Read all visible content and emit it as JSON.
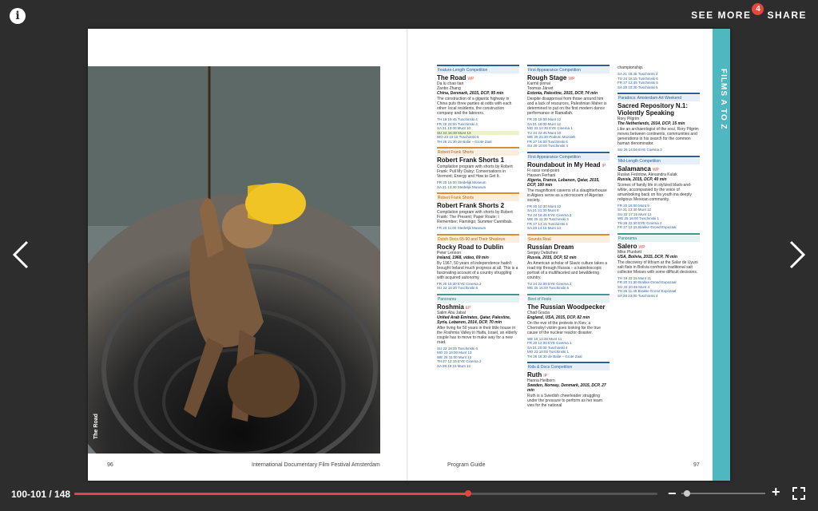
{
  "toolbar": {
    "info_label": "i",
    "see_more_label": "SEE MORE",
    "see_more_badge": "4",
    "share_label": "SHARE"
  },
  "spread": {
    "photo_caption": "The Road",
    "side_tab": "FILMS A TO Z",
    "footer_left_page": "96",
    "footer_festival": "International Documentary Film Festival Amsterdam",
    "footer_guide": "Program Guide",
    "footer_right_page": "97"
  },
  "columns": [
    [
      {
        "section": "Feature-Length Competition",
        "style": "blue",
        "title": "The Road",
        "tag": "WP",
        "person": "Da lu chao tian\nZanbo Zhang",
        "meta": "China, Denmark, 2015, DCP, 95 min",
        "desc": "The construction of a gigantic highway in China puts three parties at odds with each other: local residents, the construction company and the laborers.",
        "shows": [
          "TH 19 19:45 Tuschinski 4",
          "FR 20 20:00 Tuschinski 4",
          "SA 21 13:00 Munt 10",
          "SU 22 16:30 Munt 13",
          "WO 23 10:15 Tuschinski 5",
          "TH 26 21:30 de Balie – Grote Zaal"
        ]
      },
      {
        "section": "Robert Frank Shorts",
        "style": "orange",
        "title": "Robert Frank Shorts 1",
        "tag": "",
        "person": "",
        "meta": "",
        "desc": "Compilation program with shorts by Robert Frank: Pull My Daisy; Conversations in Vermont; Energy and How to Get It.",
        "shows": [
          "FR 20 16:00 Stedelijk Museum",
          "SA 21 13:30 Stedelijk Museum"
        ]
      },
      {
        "section": "Robert Frank Shorts",
        "style": "orange",
        "title": "Robert Frank Shorts 2",
        "tag": "",
        "person": "",
        "meta": "",
        "desc": "Compilation program with shorts by Robert Frank: The Present; Paper Route; I Remember; Flamingo; Summer Cannibals.",
        "shows": [
          "FR 20 11:00 Stedelijk Museum"
        ]
      },
      {
        "section": "Dutch Docs 65-90 and Their Shadows",
        "style": "orange",
        "title": "Rocky Road to Dublin",
        "tag": "",
        "person": "Peter Lennon",
        "meta": "Ireland, 1968, video, 69 min",
        "desc": "By 1967, 50 years of independence hadn't brought Ireland much progress at all. This is a fascinating account of a country struggling with acquired autonomy.",
        "shows": [
          "FR 20 15:30 EYE Cinema 2",
          "SU 22 10:30 Tuschinski 6"
        ]
      },
      {
        "section": "Panorama",
        "style": "teal",
        "title": "Roshmia",
        "tag": "EP",
        "person": "Salim Abu Jabal",
        "meta": "United Arab Emirates, Qatar, Palestine, Syria, Lebanon, 2014, DCP, 70 min",
        "desc": "After living for 50 years in their little house in the Roshmia Valley in Haifa, Israel, an elderly couple has to move to make way for a new road.",
        "shows": [
          "SU 22 18:00 Tuschinski 6",
          "MO 23 16:00 Munt 13",
          "WE 25 11:00 Munt 12",
          "TH 27 12:15 EYE Cinema 2",
          "SA 28 19:15 Munt 12"
        ]
      }
    ],
    [
      {
        "section": "First Appearance Competition",
        "style": "blue",
        "title": "Rough Stage",
        "tag": "WP",
        "person": "Karmil pinnal\nToomas Järvet",
        "meta": "Estonia, Palestine, 2015, DCP, 74 min",
        "desc": "Despite disapproval from those around him and a lack of resources, Palestinian Maher is determined to put on the first modern dance performance in Ramallah.",
        "shows": [
          "FR 20 18:00 Munt 12",
          "SA 21 19:00 Munt 12",
          "MO 23 14:30 EYE Cinema 1",
          "TU 24 22:45 Munt 10",
          "WE 25 21:30 Podium Mozaiek",
          "FR 27 16:00 Tuschinski 6",
          "SU 29 10:00 Tuschinski 4"
        ]
      },
      {
        "section": "First Appearance Competition",
        "style": "blue",
        "title": "Roundabout in My Head",
        "tag": "IP",
        "person": "Fi rassi rond-point\nHassen Ferhani",
        "meta": "Algeria, France, Lebanon, Qatar, 2015, DCP, 100 min",
        "desc": "The magnificent caverns of a slaughterhouse in Algiers serve as a microcosm of Algerian society.",
        "shows": [
          "FR 20 10:30 Munt 12",
          "SA 21 21:30 Munt 9",
          "TU 24 16:45 EYE Cinema 2",
          "WE 25 11:30 Tuschinski 3",
          "FR 27 13:15 Tuschinski 4",
          "SA 28 14:15 Munt 13"
        ]
      },
      {
        "section": "Sounds Real",
        "style": "orange",
        "title": "Russian Dream",
        "tag": "",
        "person": "Sergey Debizhev",
        "meta": "Russia, 2015, DCP, 52 min",
        "desc": "An American scholar of Slavic culture takes a road trip through Russia – a kaleidoscopic portrait of a multifaceted and bewildering country.",
        "shows": [
          "TU 24 22:00 EYE Cinema 2",
          "WE 25 16:00 Tuschinski 6"
        ]
      },
      {
        "section": "Best of Fests",
        "style": "teal",
        "title": "The Russian Woodpecker",
        "tag": "",
        "person": "Chad Gracia",
        "meta": "England, USA, 2015, DCP, 82 min",
        "desc": "On the eve of the protests in Kiev, a Chernobyl victim goes looking for the true cause of the nuclear reactor disaster.",
        "shows": [
          "WE 18 14:45 Munt 11",
          "FR 20 12:00 EYE Cinema 1",
          "SA 21 20:00 Tuschinski 4",
          "MO 23 10:00 Tuschinski 1",
          "TH 26 18:30 de Balie – Grote Zaal"
        ]
      },
      {
        "section": "Kids & Docs Competition",
        "style": "blue",
        "title": "Ruth",
        "tag": "IP",
        "person": "Hanna Heilborn",
        "meta": "Sweden, Norway, Denmark, 2015, DCP, 27 min",
        "desc": "Ruth is a Swedish cheerleader struggling under the pressure to perform as her team vies for the national",
        "shows": []
      }
    ],
    [
      {
        "section": "",
        "style": "plain",
        "title": "",
        "tag": "",
        "person": "",
        "meta": "",
        "desc": "championship.",
        "shows": [
          "SA 21 18:45 Tuschinski 2",
          "TU 24 16:15 Tuschinski 6",
          "FR 27 12:45 Tuschinski 5",
          "SA 28 10:30 Tuschinski 5"
        ]
      },
      {
        "section": "Paradocs: Amsterdam Art Weekend",
        "style": "blue",
        "title": "Sacred Repository N.1: Violently Speaking",
        "tag": "",
        "person": "Rory Pilgrim",
        "meta": "The Netherlands, 2014, DCP, 15 min",
        "desc": "Like an archaeologist of the soul, Rory Pilgrim moves between continents, communities and generations in his search for the common human denominator.",
        "shows": [
          "SU 29 14:00 EYE Cinema 2"
        ]
      },
      {
        "section": "Mid-Length Competition",
        "style": "blue",
        "title": "Salamanca",
        "tag": "WP",
        "person": "Ruslan Fedotow, Alexandra Kulak",
        "meta": "Russia, 2015, DCP, 40 min",
        "desc": "Scenes of family life in stylized black-and-white, accompanied by the voice of amanlooking back on his youth ina deeply religious Mexican community.",
        "shows": [
          "FR 20 18:00 Munt 9",
          "SA 21 13:30 Munt 12",
          "SU 22 17:15 Munt 12",
          "WE 25 16:00 Tuschinski 1",
          "TH 26 22:30 EYE Cinema 2",
          "FR 27 12:15 Brakke Grond Expozaal"
        ]
      },
      {
        "section": "Panorama",
        "style": "teal",
        "title": "Salero",
        "tag": "WP",
        "person": "Mike Plunkett",
        "meta": "USA, Bolivia, 2015, DCP, 76 min",
        "desc": "The discovery of lithium at the Salar de Uyuni salt flats in Bolivia confronts traditional salt collector Moises with some difficult decisions.",
        "shows": [
          "TH 19 22:15 Munt 11",
          "FR 20 21:30 Brakke Grond Expozaal",
          "SU 22 20:45 Munt 4",
          "TH 26 11:45 Brakke Grond Expozaal",
          "SA 28 23:00 Tuschinski 4"
        ]
      }
    ]
  ],
  "bottom": {
    "page_count": "100-101 / 148",
    "progress_fraction": 0.676,
    "zoom_out_label": "−",
    "zoom_in_label": "+"
  }
}
